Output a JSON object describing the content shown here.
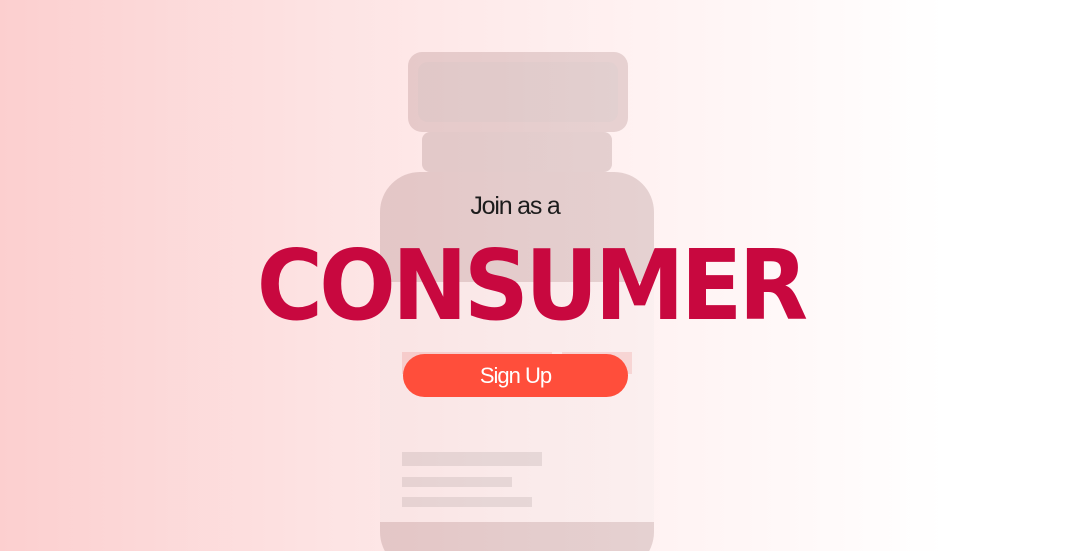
{
  "hero": {
    "kicker": "Join as a",
    "headline": "CONSUMER",
    "cta_label": "Sign Up"
  },
  "background_image": {
    "icon": "supplement-bottle-image"
  },
  "colors": {
    "headline": "#c8083f",
    "button": "#ff4e3b",
    "gradient_start": "#fccfcf",
    "gradient_end": "#ffffff"
  }
}
